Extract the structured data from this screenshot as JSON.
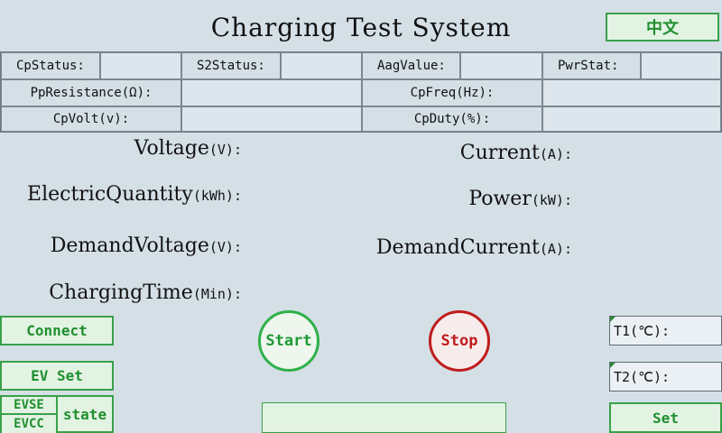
{
  "title": "Charging Test System",
  "lang_button": "中文",
  "status_grid": {
    "row1": [
      "CpStatus:",
      "S2Status:",
      "AagValue:",
      "PwrStat:"
    ],
    "row2": [
      "PpResistance(Ω):",
      "CpFreq(Hz):"
    ],
    "row3": [
      "CpVolt(v):",
      "CpDuty(%):"
    ]
  },
  "readings": {
    "voltage": {
      "label": "Voltage",
      "unit": "(V):"
    },
    "current": {
      "label": "Current",
      "unit": "(A):"
    },
    "electric_quantity": {
      "label": "ElectricQuantity",
      "unit": "(kWh):"
    },
    "power": {
      "label": "Power",
      "unit": "(kW):"
    },
    "demand_voltage": {
      "label": "DemandVoltage",
      "unit": "(V):"
    },
    "demand_current": {
      "label": "DemandCurrent",
      "unit": "(A):"
    },
    "charging_time": {
      "label": "ChargingTime",
      "unit": "(Min):"
    }
  },
  "buttons": {
    "connect": "Connect",
    "ev_set": "EV Set",
    "evse": "EVSE",
    "evcc": "EVCC",
    "state": "state",
    "start": "Start",
    "stop": "Stop",
    "set": "Set"
  },
  "temps": {
    "t1": "T1(℃):",
    "t2": "T2(℃):"
  },
  "colors": {
    "accent_green": "#3aa04a",
    "stop_red": "#c01c1c",
    "background": "#d4dfe6"
  }
}
